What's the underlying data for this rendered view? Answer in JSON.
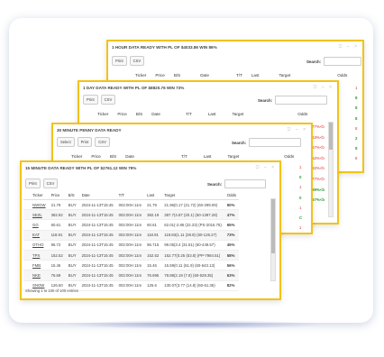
{
  "panels": {
    "p1h": {
      "title": "1 HOUR DATA READY WITH PL OF $4033.86 WIN 86%",
      "buttons": [
        "Print",
        "CSV"
      ],
      "search_label": "Search:",
      "columns": [
        "Ticker",
        "Price",
        "B/S",
        "Date",
        "T/T",
        "Last",
        "Target",
        "Odds"
      ],
      "side_values": [
        "1",
        "8",
        "8",
        "8",
        "8",
        "2",
        "8",
        "8"
      ]
    },
    "p1d": {
      "title": "1 DAY DATA READY WITH PL OF $8820.76 WIN 73%",
      "buttons": [
        "Print",
        "CSV"
      ],
      "search_label": "Search:",
      "columns": [
        "Ticker",
        "Price",
        "B/S",
        "Date",
        "T/T",
        "Last",
        "Target",
        "Odds"
      ],
      "side_values": [
        "77%<b",
        "63%<b",
        "67%<b",
        "62%<b",
        "82%<b",
        "77%<b",
        "89%<b",
        "67%<b"
      ]
    },
    "p30": {
      "title": "30 MINUTE PENNY DATA READY",
      "buttons": [
        "Select",
        "Print",
        "CSV"
      ],
      "search_label": "Search:",
      "columns": [
        "Ticker",
        "Price",
        "B/S",
        "Date",
        "T/T",
        "Last",
        "Target",
        "Odds"
      ],
      "side_values": [
        "1",
        "0",
        "1",
        "0",
        "1",
        "C",
        "1",
        "C"
      ]
    },
    "p15": {
      "title": "15 MINUTE DATA READY WITH PL OF $2761.12 WIN 79%",
      "buttons": [
        "Print",
        "CSV"
      ],
      "search_label": "Search:",
      "columns": [
        "Ticker",
        "Price",
        "B/S",
        "Date",
        "T/T",
        "Last",
        "Target",
        "Odds"
      ],
      "rows": [
        {
          "ticker": "NWGW",
          "price": "21.79",
          "bs": "BUY",
          "date": "2024-11-13T15:45",
          "tt": "002:00H 11m",
          "last": "21.79",
          "target": "21.96(0.17 (21.72) (60-299.09)",
          "odds": "90%"
        },
        {
          "ticker": "SEZL",
          "price": "382.92",
          "bs": "BUY",
          "date": "2024-11-13T15:45",
          "tt": "002:00H 11m",
          "last": "382.19",
          "target": "387.7(4.87 (20.1) (60-1397.28)",
          "odds": "47%"
        },
        {
          "ticker": "GG",
          "price": "60.61",
          "bs": "BUY",
          "date": "2024-11-13T15:45",
          "tt": "002:00H 11m",
          "last": "60.61",
          "target": "62.01(-2.86 (22.23) (PS-2016.75)",
          "odds": "65%"
        },
        {
          "ticker": "EAT",
          "price": "118.91",
          "bs": "BUY",
          "date": "2024-11-13T15:45",
          "tt": "002:00H 11m",
          "last": "118.91",
          "target": "119.83(1.11 (28.8) (60-126.27)",
          "odds": "73%"
        },
        {
          "ticker": "OTHO",
          "price": "96.72",
          "bs": "BUY",
          "date": "2024-11-13T15:45",
          "tt": "002:00H 11m",
          "last": "96.715",
          "target": "99.05(3.4 (31.51) (60-449.57)",
          "odds": "45%"
        },
        {
          "ticker": "TPX",
          "price": "152.52",
          "bs": "BUY",
          "date": "2024-11-13T15:45",
          "tt": "002:00H 11m",
          "last": "152.52",
          "target": "152.77(0.25 (53.8) (PP-7984.51)",
          "odds": "58%"
        },
        {
          "ticker": "FMB",
          "price": "15.46",
          "bs": "BUY",
          "date": "2024-11-13T15:45",
          "tt": "002:00H 11m",
          "last": "15.46",
          "target": "15.59(0.11 (61.9) (60-643.13)",
          "odds": "56%"
        },
        {
          "ticker": "NKE",
          "price": "76.69",
          "bs": "BUY",
          "date": "2024-11-13T15:45",
          "tt": "002:00H 11m",
          "last": "76.695",
          "target": "78.88(2.19 (7.8) (60-528.35)",
          "odds": "63%"
        },
        {
          "ticker": "SNOW",
          "price": "126.60",
          "bs": "BUY",
          "date": "2024-11-13T15:45",
          "tt": "002:00H 11m",
          "last": "126.6",
          "target": "130.07(3.77 (14.8) (60-61.36)",
          "odds": "82%"
        }
      ],
      "footer": "Showing 1 to 100 of 100 entries"
    }
  },
  "colors": {
    "accent_border": "#f2c316",
    "buy": "#2e9c2e",
    "ticker": "#c0392b"
  }
}
